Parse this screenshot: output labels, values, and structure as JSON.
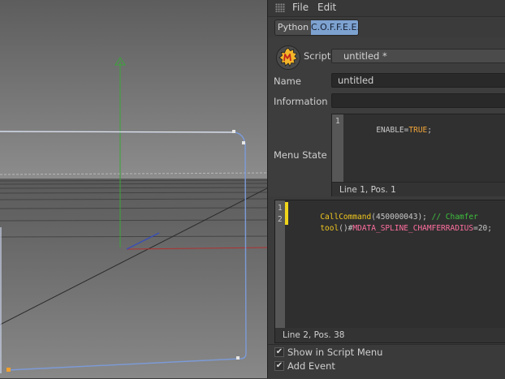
{
  "menubar": {
    "file_label": "File",
    "edit_label": "Edit"
  },
  "tabs": [
    {
      "label": "Python",
      "active": false
    },
    {
      "label": "C.O.F.F.E.E.",
      "active": true
    }
  ],
  "script_row": {
    "label": "Script",
    "value": "untitled *"
  },
  "name_row": {
    "label": "Name",
    "value": "untitled"
  },
  "information_row": {
    "label": "Information",
    "value": ""
  },
  "menu_state": {
    "label": "Menu State",
    "line_number": "1",
    "code": {
      "kw1": "ENABLE",
      "op": "=",
      "kw2": "TRUE",
      "end": ";"
    },
    "status": "Line 1, Pos. 1"
  },
  "editor": {
    "line_numbers": [
      "1",
      "2"
    ],
    "line1": {
      "fn": "CallCommand",
      "args": "(450000043);",
      "comment": " // Chamfer"
    },
    "line2": {
      "fn": "tool",
      "mid": "()#",
      "const": "MDATA_SPLINE_CHAMFERRADIUS",
      "tail": "=20;"
    },
    "status": "Line 2, Pos. 38"
  },
  "options": {
    "show_in_script_menu": {
      "label": "Show in Script Menu",
      "checked": true,
      "mark": "✔"
    },
    "add_event": {
      "label": "Add Event",
      "checked": true,
      "mark": "✔"
    }
  },
  "icons": {
    "grip": "grip-dots-icon",
    "coffee": "coffee-script-icon"
  },
  "colors": {
    "active_tab": "#7da2d0",
    "spline": "#7c9bd8",
    "y_axis": "#3aa53a",
    "x_axis": "#b03030"
  }
}
